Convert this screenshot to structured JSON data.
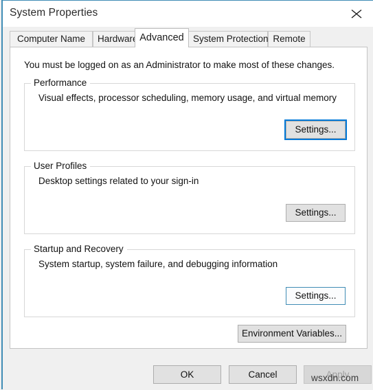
{
  "window": {
    "title": "System Properties",
    "close_icon": "close-icon",
    "accent_color": "#0078d7",
    "border_color": "#3f8cb5"
  },
  "tabs": [
    {
      "label": "Computer Name",
      "selected": false
    },
    {
      "label": "Hardware",
      "selected": false
    },
    {
      "label": "Advanced",
      "selected": true
    },
    {
      "label": "System Protection",
      "selected": false
    },
    {
      "label": "Remote",
      "selected": false
    }
  ],
  "page": {
    "admin_note": "You must be logged on as an Administrator to make most of these changes.",
    "groups": [
      {
        "title": "Performance",
        "description": "Visual effects, processor scheduling, memory usage, and virtual memory",
        "button_label": "Settings...",
        "button_state": "focused"
      },
      {
        "title": "User Profiles",
        "description": "Desktop settings related to your sign-in",
        "button_label": "Settings...",
        "button_state": "normal"
      },
      {
        "title": "Startup and Recovery",
        "description": "System startup, system failure, and debugging information",
        "button_label": "Settings...",
        "button_state": "hover"
      }
    ],
    "environment_variables_label": "Environment Variables..."
  },
  "commands": {
    "ok_label": "OK",
    "cancel_label": "Cancel",
    "apply_label": "Apply",
    "apply_disabled": true
  },
  "watermark": {
    "text": "wsxdn.com"
  }
}
